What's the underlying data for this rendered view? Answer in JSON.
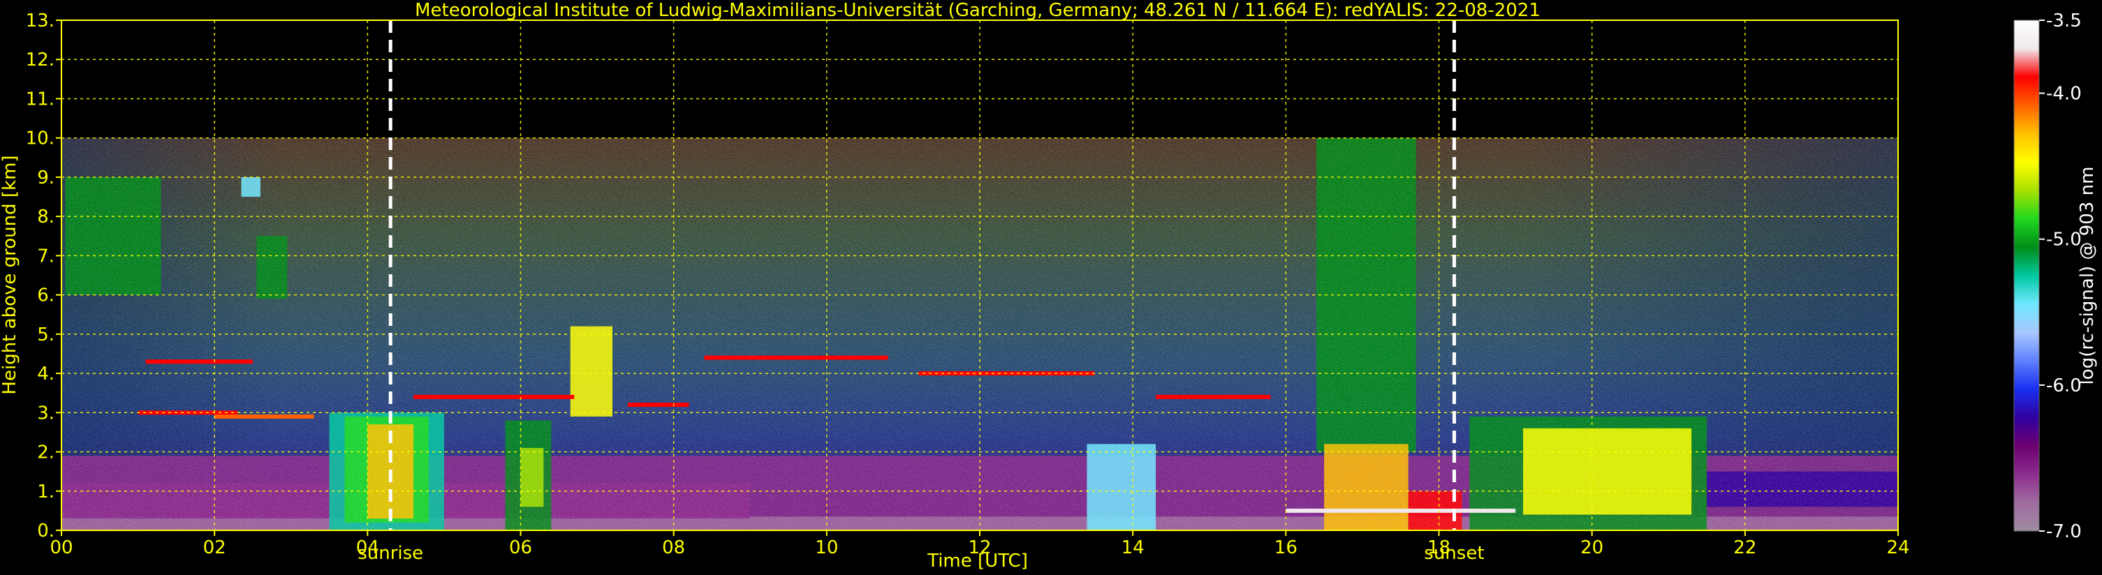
{
  "chart_data": {
    "type": "heatmap",
    "title": "Meteorological Institute of Ludwig-Maximilians-Universität (Garching, Germany; 48.261 N / 11.664 E):    redYALIS: 22-08-2021",
    "xlabel": "Time [UTC]",
    "ylabel": "Height above ground [km]",
    "xlim": [
      0,
      24
    ],
    "ylim": [
      0,
      13
    ],
    "x_ticks": [
      "00",
      "02",
      "04",
      "06",
      "08",
      "10",
      "12",
      "14",
      "16",
      "18",
      "20",
      "22",
      "24"
    ],
    "y_ticks": [
      "0.",
      "1.",
      "2.",
      "3.",
      "4.",
      "5.",
      "6.",
      "7.",
      "8.",
      "9.",
      "10.",
      "11.",
      "12.",
      "13."
    ],
    "grid": true,
    "data_top_km": 10,
    "markers": [
      {
        "name": "sunrise",
        "time": 4.3,
        "label": "sunrise"
      },
      {
        "name": "sunset",
        "time": 18.2,
        "label": "sunset"
      }
    ],
    "colorbar": {
      "label": "log(rc-signal) @ 903 nm",
      "min": -7.0,
      "max": -3.5,
      "ticks": [
        "-3.5",
        "-4.0",
        "-5.0",
        "-6.0",
        "-7.0"
      ],
      "colors": [
        "#ffffff",
        "#f0e8ec",
        "#ff0000",
        "#ff6000",
        "#ffc000",
        "#ffff00",
        "#a8e000",
        "#20d820",
        "#008c18",
        "#00c8a0",
        "#70e8ff",
        "#a8c8ff",
        "#6080ff",
        "#1830f0",
        "#3000a0",
        "#6c0070",
        "#8c2c8c",
        "#a06ca0",
        "#a08ca0"
      ]
    },
    "regions": [
      {
        "t0": 0.0,
        "t1": 24.0,
        "h0": 0.0,
        "h1": 1.9,
        "v": -6.6
      },
      {
        "t0": 0.0,
        "t1": 24.0,
        "h0": 0.0,
        "h1": 0.35,
        "v": -6.85
      },
      {
        "t0": 0.0,
        "t1": 9.0,
        "h0": 0.3,
        "h1": 1.2,
        "v": -6.7
      },
      {
        "t0": 3.5,
        "t1": 5.0,
        "h0": 0.0,
        "h1": 3.0,
        "v": -5.3
      },
      {
        "t0": 3.7,
        "t1": 4.8,
        "h0": 0.2,
        "h1": 2.9,
        "v": -4.8
      },
      {
        "t0": 4.0,
        "t1": 4.6,
        "h0": 0.3,
        "h1": 2.7,
        "v": -4.2
      },
      {
        "t0": 5.8,
        "t1": 6.4,
        "h0": 0.0,
        "h1": 2.8,
        "v": -5.0
      },
      {
        "t0": 6.0,
        "t1": 6.3,
        "h0": 0.6,
        "h1": 2.1,
        "v": -4.7
      },
      {
        "t0": 0.05,
        "t1": 1.3,
        "h0": 6.0,
        "h1": 9.0,
        "v": -5.0
      },
      {
        "t0": 2.55,
        "t1": 2.95,
        "h0": 5.9,
        "h1": 7.5,
        "v": -5.1
      },
      {
        "t0": 2.35,
        "t1": 2.6,
        "h0": 8.5,
        "h1": 9.0,
        "v": -5.4
      },
      {
        "t0": 6.65,
        "t1": 7.2,
        "h0": 2.9,
        "h1": 5.2,
        "v": -4.4
      },
      {
        "t0": 13.4,
        "t1": 14.3,
        "h0": 0.0,
        "h1": 2.2,
        "v": -5.5
      },
      {
        "t0": 16.4,
        "t1": 17.7,
        "h0": 2.0,
        "h1": 10.0,
        "v": -5.0
      },
      {
        "t0": 16.5,
        "t1": 17.6,
        "h0": 0.0,
        "h1": 2.2,
        "v": -4.3
      },
      {
        "t0": 17.6,
        "t1": 18.3,
        "h0": 0.0,
        "h1": 1.0,
        "v": -3.9
      },
      {
        "t0": 18.4,
        "t1": 21.5,
        "h0": 0.0,
        "h1": 2.9,
        "v": -5.0
      },
      {
        "t0": 19.1,
        "t1": 21.3,
        "h0": 0.4,
        "h1": 2.6,
        "v": -4.5
      },
      {
        "t0": 21.5,
        "t1": 24.0,
        "h0": 0.6,
        "h1": 1.5,
        "v": -6.3
      }
    ],
    "cloud_layers": [
      {
        "t0": 1.0,
        "t1": 2.3,
        "h": 3.0,
        "v": -3.9
      },
      {
        "t0": 1.1,
        "t1": 2.5,
        "h": 4.3,
        "v": -3.9
      },
      {
        "t0": 2.0,
        "t1": 3.3,
        "h": 2.9,
        "v": -4.0
      },
      {
        "t0": 4.6,
        "t1": 6.7,
        "h": 3.4,
        "v": -3.8
      },
      {
        "t0": 7.4,
        "t1": 8.2,
        "h": 3.2,
        "v": -3.9
      },
      {
        "t0": 8.4,
        "t1": 10.8,
        "h": 4.4,
        "v": -3.8
      },
      {
        "t0": 11.2,
        "t1": 13.5,
        "h": 4.0,
        "v": -3.9
      },
      {
        "t0": 14.3,
        "t1": 15.8,
        "h": 3.4,
        "v": -3.9
      },
      {
        "t0": 16.0,
        "t1": 19.0,
        "h": 0.5,
        "v": -3.6
      }
    ]
  },
  "labels": {
    "sunrise": "sunrise",
    "sunset": "sunset"
  }
}
